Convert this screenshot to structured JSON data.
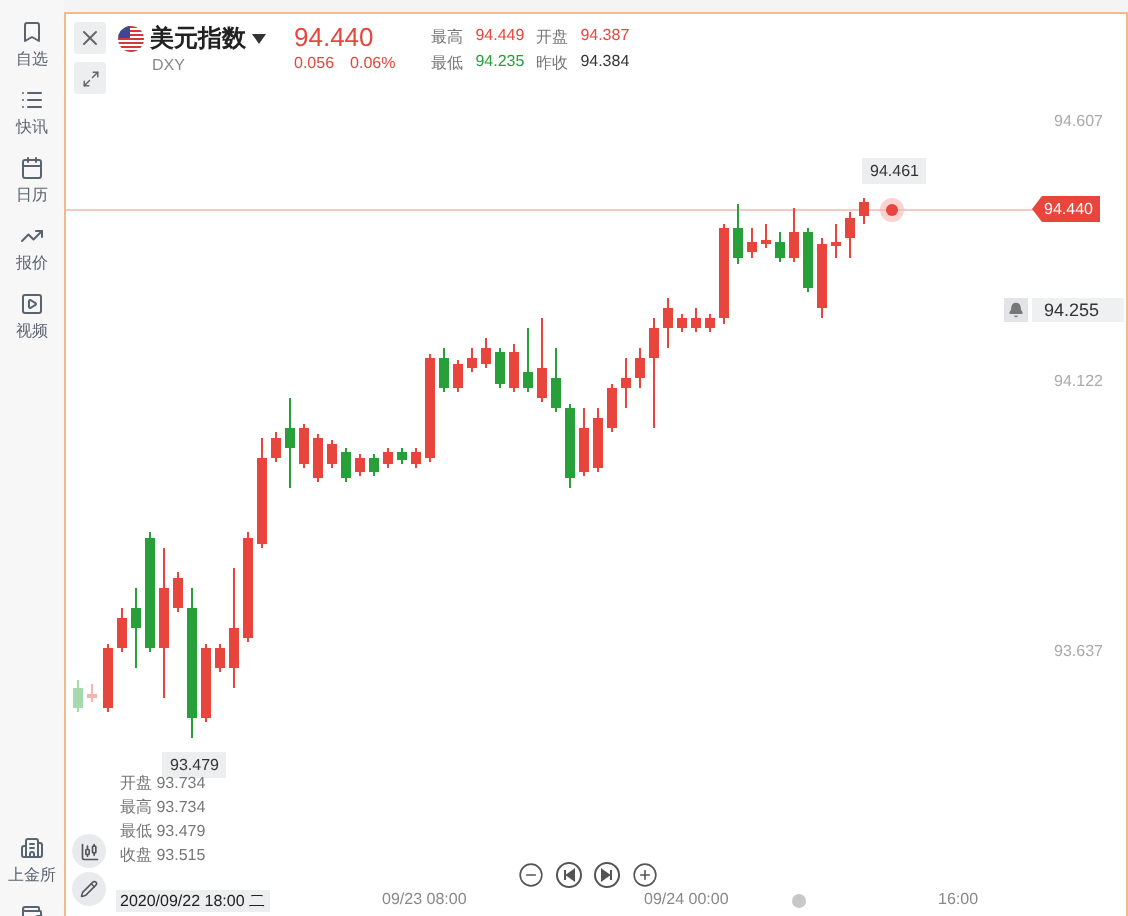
{
  "sidebar": {
    "items": [
      {
        "label": "自选",
        "selected": false
      },
      {
        "label": "快讯",
        "selected": false
      },
      {
        "label": "日历",
        "selected": false
      },
      {
        "label": "报价",
        "selected": false
      },
      {
        "label": "视频",
        "selected": false
      }
    ],
    "bottom_items": [
      {
        "label": "上金所"
      }
    ]
  },
  "header": {
    "name": "美元指数",
    "symbol": "DXY",
    "price": "94.440",
    "change": "0.056",
    "change_percent": "0.06%",
    "stats": [
      {
        "label": "最高",
        "value": "94.449",
        "color": "#e8453c"
      },
      {
        "label": "开盘",
        "value": "94.387",
        "color": "#e8453c"
      },
      {
        "label": "最低",
        "value": "94.235",
        "color": "#27a03a"
      },
      {
        "label": "昨收",
        "value": "94.384",
        "color": "#333333"
      }
    ]
  },
  "chart": {
    "price_axis": [
      "94.607",
      "94.122",
      "93.637"
    ],
    "current_price": "94.440",
    "alert_price": "94.255",
    "high_tooltip": "94.461",
    "low_tooltip": "93.479",
    "ohlc_legend": [
      {
        "label": "开盘",
        "value": "93.734"
      },
      {
        "label": "最高",
        "value": "93.734"
      },
      {
        "label": "最低",
        "value": "93.479"
      },
      {
        "label": "收盘",
        "value": "93.515"
      }
    ],
    "cursor_time": "2020/09/22 18:00 二",
    "time_axis": [
      "09/23 08:00",
      "09/24 00:00",
      "16:00"
    ]
  }
}
